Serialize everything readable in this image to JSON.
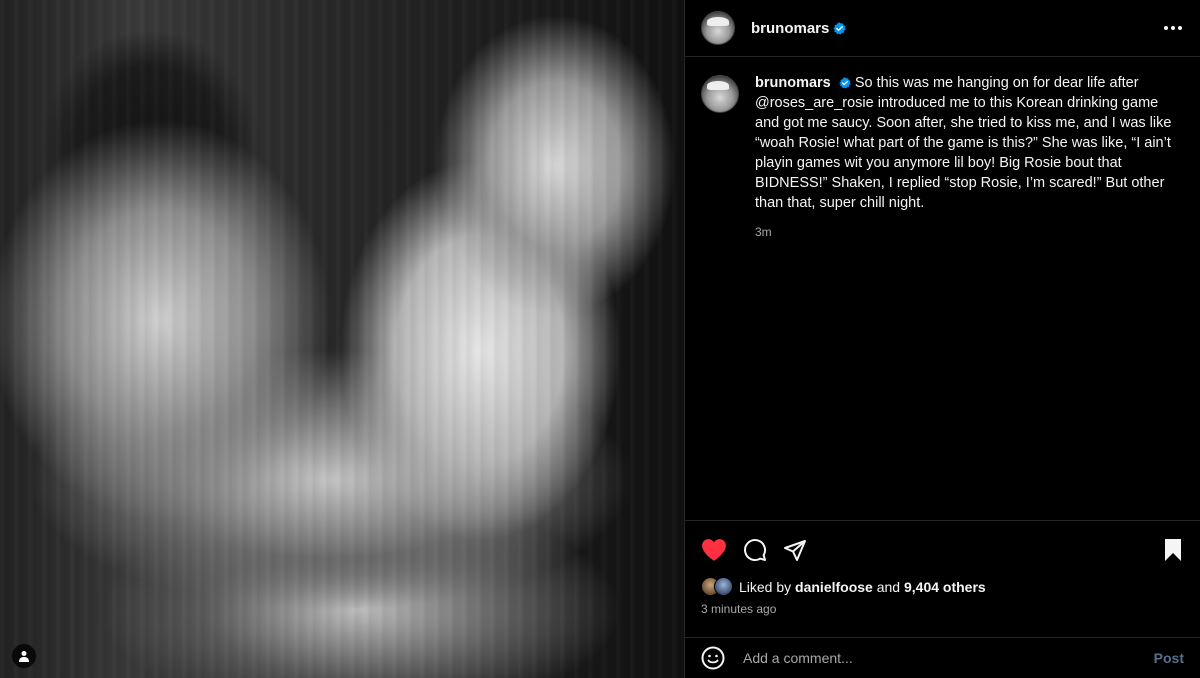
{
  "post": {
    "username": "brunomars",
    "caption": {
      "username": "brunomars",
      "text": "So this was me hanging on for dear life after @roses_are_rosie introduced me to this Korean drinking game and got me saucy. Soon after, she tried to kiss me, and I was like “woah Rosie! what part of the game is this?” She was like, “I ain’t playin games wit you anymore lil boy! Big Rosie bout that BIDNESS!” Shaken, I replied “stop Rosie, I’m scared!” But other than that, super chill night.",
      "time": "3m"
    },
    "likes": {
      "prefix": "Liked by",
      "user": "danielfoose",
      "and": "and",
      "others": "9,404 others"
    },
    "time_ago": "3 minutes ago",
    "comment": {
      "placeholder": "Add a comment...",
      "post_label": "Post"
    },
    "colors": {
      "heart": "#ff3040",
      "verified": "#0095f6",
      "post_button": "#5a6f8e"
    },
    "icons": [
      "verified-icon",
      "more-icon",
      "heart-icon",
      "comment-icon",
      "share-icon",
      "bookmark-icon",
      "emoji-icon",
      "user-tag-icon"
    ]
  }
}
